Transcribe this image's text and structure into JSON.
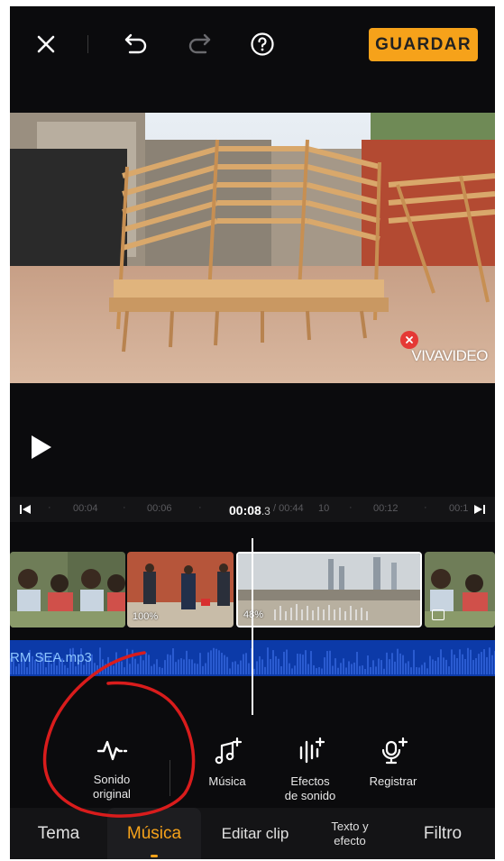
{
  "topbar": {
    "close_icon": "close-icon",
    "undo_icon": "undo-icon",
    "redo_icon": "redo-icon",
    "help_icon": "help-icon",
    "save_label": "GUARDAR"
  },
  "preview": {
    "watermark": "VIVAVIDEO"
  },
  "ruler": {
    "ticks": [
      "00:04",
      "00:06",
      "10",
      "00:12",
      "00:1"
    ],
    "current_time": "00:08",
    "current_time_fraction": ".3",
    "total_time": "/ 00:44"
  },
  "clips": [
    {
      "label": ""
    },
    {
      "label": "100%"
    },
    {
      "label": "48%"
    },
    {
      "label": ""
    }
  ],
  "audio": {
    "track_name": "RM SEA.mp3"
  },
  "tools": [
    {
      "label": "Sonido original",
      "line1": "Sonido",
      "line2": "original",
      "icon": "waveform-icon"
    },
    {
      "label": "Música",
      "icon": "music-add-icon"
    },
    {
      "label": "Efectos de sonido",
      "line1": "Efectos",
      "line2": "de sonido",
      "icon": "sound-effects-icon"
    },
    {
      "label": "Registrar",
      "icon": "microphone-add-icon"
    }
  ],
  "tabs": [
    {
      "label": "Tema",
      "active": false
    },
    {
      "label": "Música",
      "active": true
    },
    {
      "label": "Editar clip",
      "active": false
    },
    {
      "label": "Texto y efecto",
      "line1": "Texto y",
      "line2": "efecto",
      "active": false
    },
    {
      "label": "Filtro",
      "active": false
    }
  ],
  "colors": {
    "accent": "#f6a21a",
    "background": "#0b0b0d",
    "audio_track": "#0c3aa8",
    "annotation": "#d91c1c"
  }
}
